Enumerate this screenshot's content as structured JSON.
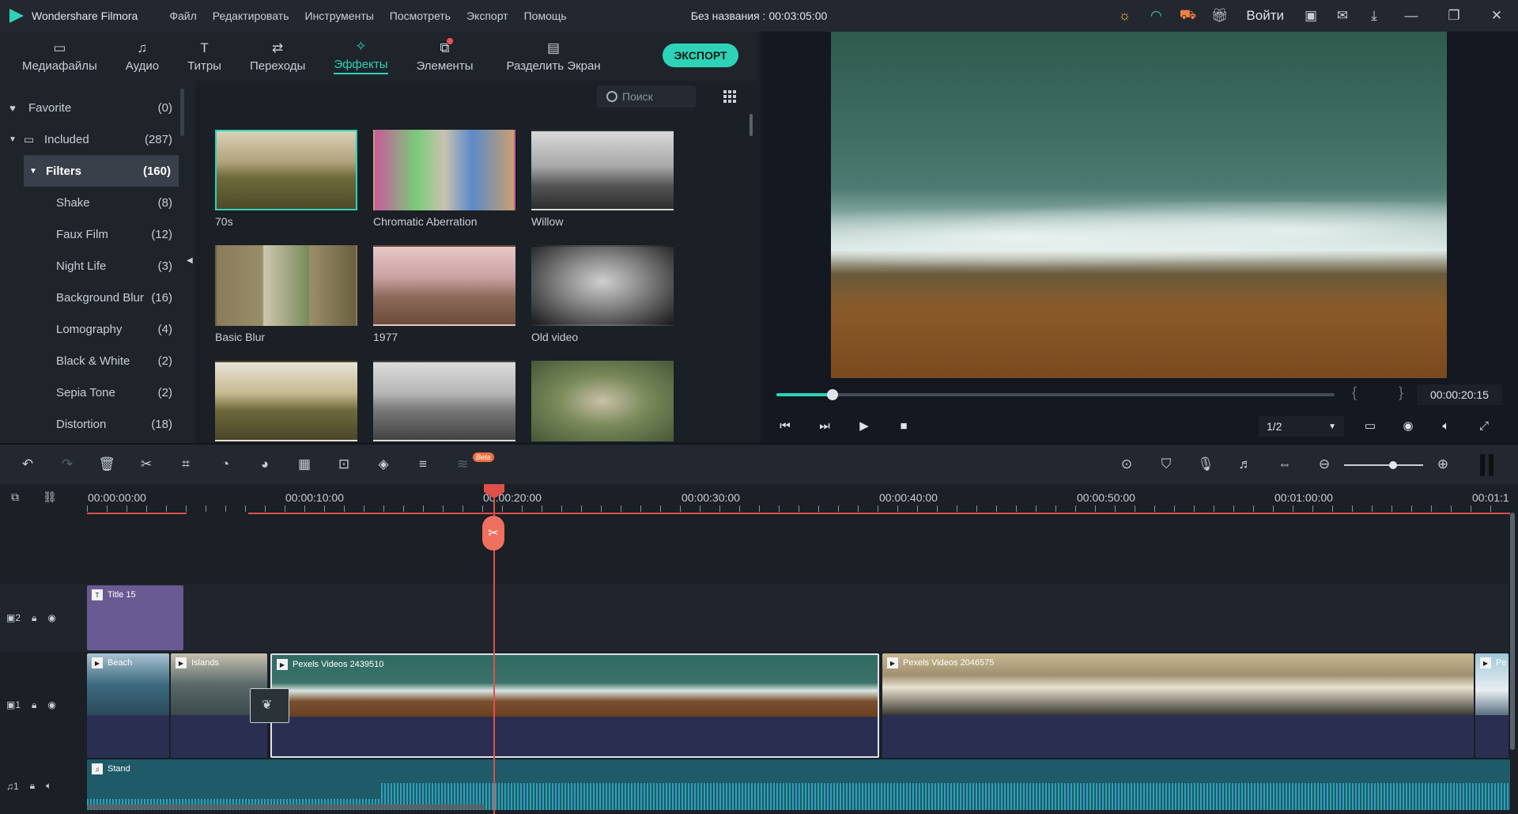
{
  "app": {
    "name": "Wondershare Filmora",
    "project_title": "Без названия : 00:03:05:00",
    "menus": [
      "Файл",
      "Редактировать",
      "Инструменты",
      "Посмотреть",
      "Экспорт",
      "Помощь"
    ],
    "login": "Войти"
  },
  "tabs": [
    {
      "label": "Медиафайлы",
      "icon": "folder-icon"
    },
    {
      "label": "Аудио",
      "icon": "music-note-icon"
    },
    {
      "label": "Титры",
      "icon": "text-icon"
    },
    {
      "label": "Переходы",
      "icon": "transition-icon"
    },
    {
      "label": "Эффекты",
      "icon": "effects-icon",
      "active": true
    },
    {
      "label": "Элементы",
      "icon": "elements-icon",
      "badge": true
    },
    {
      "label": "Разделить Экран",
      "icon": "split-screen-icon"
    }
  ],
  "export_label": "ЭКСПОРТ",
  "categories": {
    "favorite": {
      "label": "Favorite",
      "count": "(0)"
    },
    "included": {
      "label": "Included",
      "count": "(287)"
    },
    "filters": {
      "label": "Filters",
      "count": "(160)"
    },
    "sub": [
      {
        "label": "Shake",
        "count": "(8)"
      },
      {
        "label": "Faux Film",
        "count": "(12)"
      },
      {
        "label": "Night Life",
        "count": "(3)"
      },
      {
        "label": "Background Blur",
        "count": "(16)"
      },
      {
        "label": "Lomography",
        "count": "(4)"
      },
      {
        "label": "Black & White",
        "count": "(2)"
      },
      {
        "label": "Sepia Tone",
        "count": "(2)"
      },
      {
        "label": "Distortion",
        "count": "(18)"
      }
    ]
  },
  "search_placeholder": "Поиск",
  "effects": [
    {
      "label": "70s",
      "selected": true,
      "tone": "warm"
    },
    {
      "label": "Chromatic Aberration",
      "tone": "rgb"
    },
    {
      "label": "Willow",
      "tone": "bw"
    },
    {
      "label": "Basic Blur",
      "tone": "blur"
    },
    {
      "label": "1977",
      "tone": "pink"
    },
    {
      "label": "Old video",
      "tone": "bw-dark"
    },
    {
      "label": "",
      "tone": "warm"
    },
    {
      "label": "",
      "tone": "bw"
    },
    {
      "label": "",
      "tone": "blur-color"
    }
  ],
  "preview": {
    "timecode": "00:00:20:15",
    "ratio": "1/2",
    "progress": 0.1
  },
  "ruler_labels": [
    "00:00:00:00",
    "00:00:10:00",
    "00:00:20:00",
    "00:00:30:00",
    "00:00:40:00",
    "00:00:50:00",
    "00:01:00:00",
    "00:01:1"
  ],
  "tracks": {
    "title_track": "2",
    "video_track": "1",
    "audio_track": "1"
  },
  "clips": {
    "title": "Title 15",
    "beach": "Beach",
    "islands": "Islands",
    "main": "Pexels Videos 2439510",
    "second": "Pexels Videos 2046575",
    "third": "Pe",
    "audio": "Stand"
  },
  "colors": {
    "accent": "#2ed3b7",
    "playhead": "#e0504a",
    "title_clip": "#6a5a93"
  }
}
